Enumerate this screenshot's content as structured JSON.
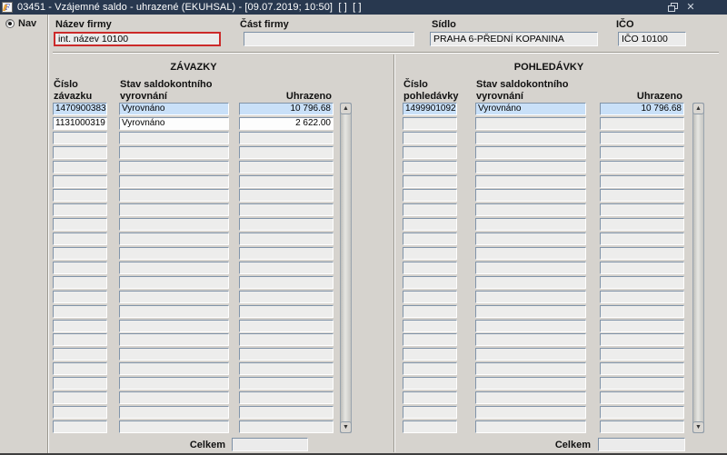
{
  "colors": {
    "titlebar": "#28384f",
    "highlight_row": "#c9e0f8",
    "focus_border": "#cc2a2a",
    "background": "#d6d3ce"
  },
  "titlebar": {
    "logo_letter": "F",
    "title": "03451 - Vzájemné saldo - uhrazené (EKUHSAL) - [09.07.2019; 10:50]  [ ]  [ ]",
    "close_glyph": "✕"
  },
  "sidebar": {
    "nav_label": "Nav"
  },
  "form": {
    "fields": [
      {
        "label": "Název firmy",
        "value": "int. název 10100"
      },
      {
        "label": "Část firmy",
        "value": ""
      },
      {
        "label": "Sídlo",
        "value": "PRAHA 6-PŘEDNÍ KOPANINA"
      },
      {
        "label": "IČO",
        "value": "IČO 10100"
      }
    ]
  },
  "zavazky": {
    "title": "ZÁVAZKY",
    "col1_line1": "Číslo",
    "col1_line2": "závazku",
    "col2_line1": "Stav saldokontního",
    "col2_line2": "vyrovnání",
    "col3": "Uhrazeno",
    "rows": [
      {
        "cislo": "1470900383",
        "stav": "Vyrovnáno",
        "uhrazeno": "10 796.68",
        "selected": true
      },
      {
        "cislo": "1131000319",
        "stav": "Vyrovnáno",
        "uhrazeno": "2 622.00",
        "selected": false
      }
    ],
    "visible_row_count": 23,
    "celkem_label": "Celkem",
    "celkem_value": ""
  },
  "pohledavky": {
    "title": "POHLEDÁVKY",
    "col1_line1": "Číslo",
    "col1_line2": "pohledávky",
    "col2_line1": "Stav saldokontního",
    "col2_line2": "vyrovnání",
    "col3": "Uhrazeno",
    "rows": [
      {
        "cislo": "1499901092",
        "stav": "Vyrovnáno",
        "uhrazeno": "10 796.68",
        "selected": true
      }
    ],
    "visible_row_count": 23,
    "celkem_label": "Celkem",
    "celkem_value": ""
  }
}
